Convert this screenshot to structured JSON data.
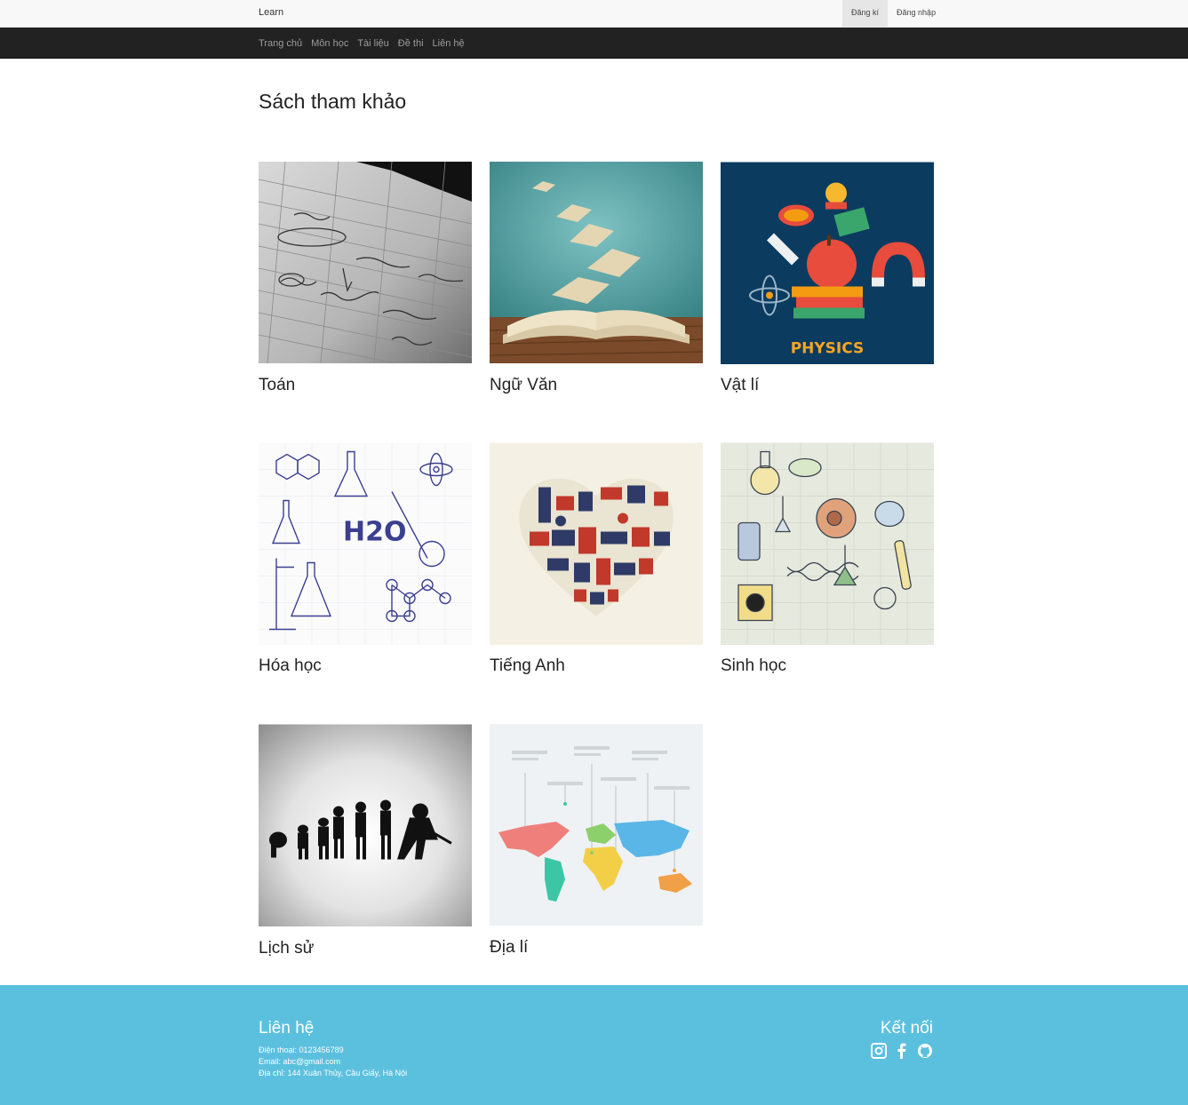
{
  "header": {
    "brand": "Learn",
    "register": "Đăng kí",
    "login": "Đăng nhập"
  },
  "nav": {
    "items": [
      "Trang chủ",
      "Môn học",
      "Tài liệu",
      "Đề thi",
      "Liên hệ"
    ]
  },
  "page": {
    "title": "Sách tham khảo"
  },
  "subjects": [
    {
      "label": "Toán",
      "icon": "math-notes-image"
    },
    {
      "label": "Ngữ Văn",
      "icon": "flying-book-image"
    },
    {
      "label": "Vật lí",
      "icon": "physics-illustration-image",
      "badge": "PHYSICS"
    },
    {
      "label": "Hóa học",
      "icon": "chemistry-doodle-image",
      "formula": "H2O"
    },
    {
      "label": "Tiếng Anh",
      "icon": "london-heart-image"
    },
    {
      "label": "Sinh học",
      "icon": "biology-doodle-image"
    },
    {
      "label": "Lịch sử",
      "icon": "evolution-silhouette-image"
    },
    {
      "label": "Địa lí",
      "icon": "world-map-infographic-image"
    }
  ],
  "footer": {
    "contact_title": "Liên hệ",
    "phone": "Điện thoại: 0123456789",
    "email": "Email: abc@gmail.com",
    "address": "Địa chỉ: 144 Xuân Thủy, Cầu Giấy, Hà Nội",
    "connect_title": "Kết nối",
    "social_icons": [
      "instagram-icon",
      "facebook-icon",
      "github-icon"
    ]
  },
  "colors": {
    "footer_bg": "#5bc0de",
    "navbar_bg": "#222222",
    "topbar_bg": "#f8f8f8"
  }
}
